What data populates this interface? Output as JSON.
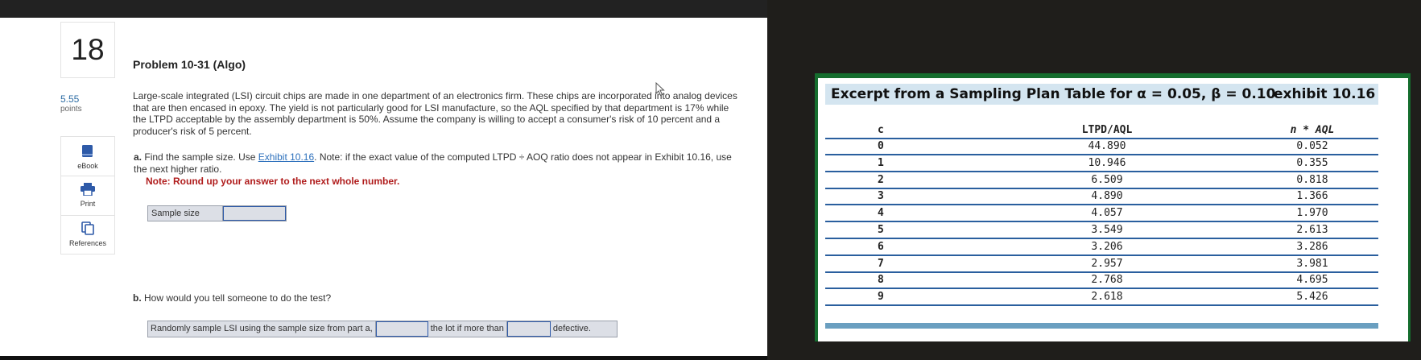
{
  "question": {
    "number": "18",
    "points_value": "5.55",
    "points_label": "points"
  },
  "tools": [
    {
      "label": "eBook",
      "icon": "book-icon"
    },
    {
      "label": "Print",
      "icon": "printer-icon"
    },
    {
      "label": "References",
      "icon": "documents-icon"
    }
  ],
  "problem": {
    "title": "Problem 10-31 (Algo)",
    "paragraph": "Large-scale integrated (LSI) circuit chips are made in one department of an electronics firm. These chips are incorporated into analog devices that are then encased in epoxy. The yield is not particularly good for LSI manufacture, so the AQL specified by that department is 17% while the LTPD acceptable by the assembly department is 50%. Assume the company is willing to accept a consumer's risk of 10 percent and a producer's risk of 5 percent.",
    "part_a": {
      "letter": "a.",
      "text_before": "Find the sample size. Use ",
      "link": "Exhibit 10.16",
      "text_after": ". Note: if the exact value of the computed LTPD ÷ AOQ ratio does not appear in Exhibit 10.16, use the next higher ratio.",
      "note": "Note: Round up your answer to the next whole number.",
      "field_label": "Sample size",
      "field_value": ""
    },
    "part_b": {
      "letter": "b.",
      "text": "How would you tell someone to do the test?",
      "seg1": "Randomly sample LSI using the sample size from part a,",
      "seg2": "the lot if more than",
      "seg3": "defective.",
      "input1_value": "",
      "input2_value": ""
    }
  },
  "exhibit": {
    "title": "Excerpt from a Sampling Plan Table for α = 0.05, β = 0.10",
    "label": "exhibit 10.16",
    "headers": {
      "c": "c",
      "ltpd": "LTPD/AQL",
      "naql": "n * AQL"
    },
    "rows": [
      {
        "c": "0",
        "ltpd": "44.890",
        "naql": "0.052"
      },
      {
        "c": "1",
        "ltpd": "10.946",
        "naql": "0.355"
      },
      {
        "c": "2",
        "ltpd": "6.509",
        "naql": "0.818"
      },
      {
        "c": "3",
        "ltpd": "4.890",
        "naql": "1.366"
      },
      {
        "c": "4",
        "ltpd": "4.057",
        "naql": "1.970"
      },
      {
        "c": "5",
        "ltpd": "3.549",
        "naql": "2.613"
      },
      {
        "c": "6",
        "ltpd": "3.206",
        "naql": "3.286"
      },
      {
        "c": "7",
        "ltpd": "2.957",
        "naql": "3.981"
      },
      {
        "c": "8",
        "ltpd": "2.768",
        "naql": "4.695"
      },
      {
        "c": "9",
        "ltpd": "2.618",
        "naql": "5.426"
      }
    ]
  },
  "colors": {
    "accent": "#2e5aa8",
    "note_red": "#b01c1c",
    "exhibit_border": "#156d2e"
  }
}
